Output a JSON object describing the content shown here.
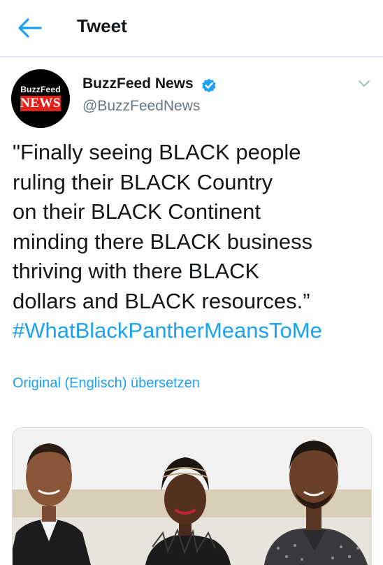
{
  "header": {
    "title": "Tweet",
    "back_icon": "arrow-left-icon"
  },
  "tweet": {
    "avatar": {
      "line1": "BuzzFeed",
      "line2": "NEWS",
      "accent": "#e32119"
    },
    "author_name": "BuzzFeed News",
    "handle": "@BuzzFeedNews",
    "verified_icon": "verified-badge-icon",
    "menu_icon": "chevron-down-icon",
    "text_lines": [
      "\"Finally seeing BLACK people",
      "ruling their BLACK Country",
      "on their BLACK Continent",
      "minding there BLACK business",
      "thriving with there BLACK",
      "dollars and BLACK resources.”"
    ],
    "hashtag": "#WhatBlackPantherMeansToMe",
    "translate_link": "Original (Englisch) übersetzen",
    "media": {
      "type": "photo"
    }
  },
  "colors": {
    "accent": "#1da1f2",
    "text": "#14171a",
    "secondary": "#657786",
    "divider": "#e1e8ed"
  }
}
